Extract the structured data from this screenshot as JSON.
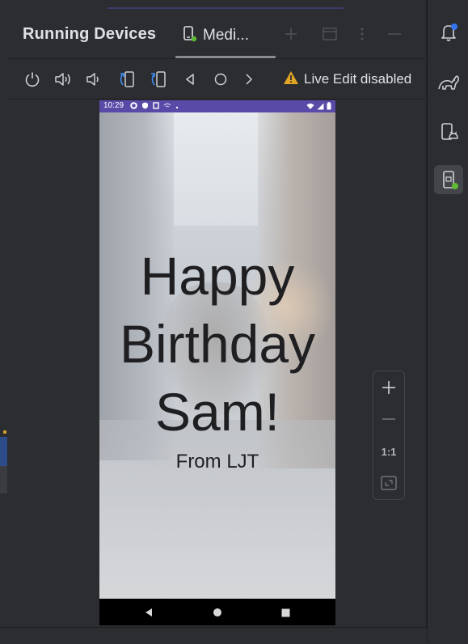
{
  "panel": {
    "title": "Running Devices",
    "tab_label": "Medi...",
    "live_edit_label": "Live Edit disabled"
  },
  "phone": {
    "status_time": "10:29",
    "greeting_line1": "Happy",
    "greeting_line2": "Birthday",
    "greeting_line3": "Sam!",
    "signature": "From LJT"
  },
  "zoom": {
    "actual_size_label": "1:1"
  },
  "colors": {
    "background": "#2b2d30",
    "status_bar": "#5a4aa8",
    "warning": "#e0a526",
    "online_dot": "#5fb832",
    "notification_dot": "#3574f0"
  },
  "icons": {
    "toolbar": [
      "power-icon",
      "volume-up-icon",
      "volume-down-icon",
      "rotate-left-icon",
      "rotate-right-icon",
      "back-icon",
      "home-icon",
      "overview-icon",
      "warning-icon"
    ],
    "header": [
      "device-tab-icon",
      "add-icon",
      "window-icon",
      "more-icon",
      "minimize-icon"
    ],
    "rightbar": [
      "notifications-icon",
      "gradle-icon",
      "device-manager-icon",
      "running-devices-icon"
    ],
    "zoom": [
      "zoom-in-icon",
      "zoom-out-icon",
      "fit-screen-icon"
    ]
  }
}
